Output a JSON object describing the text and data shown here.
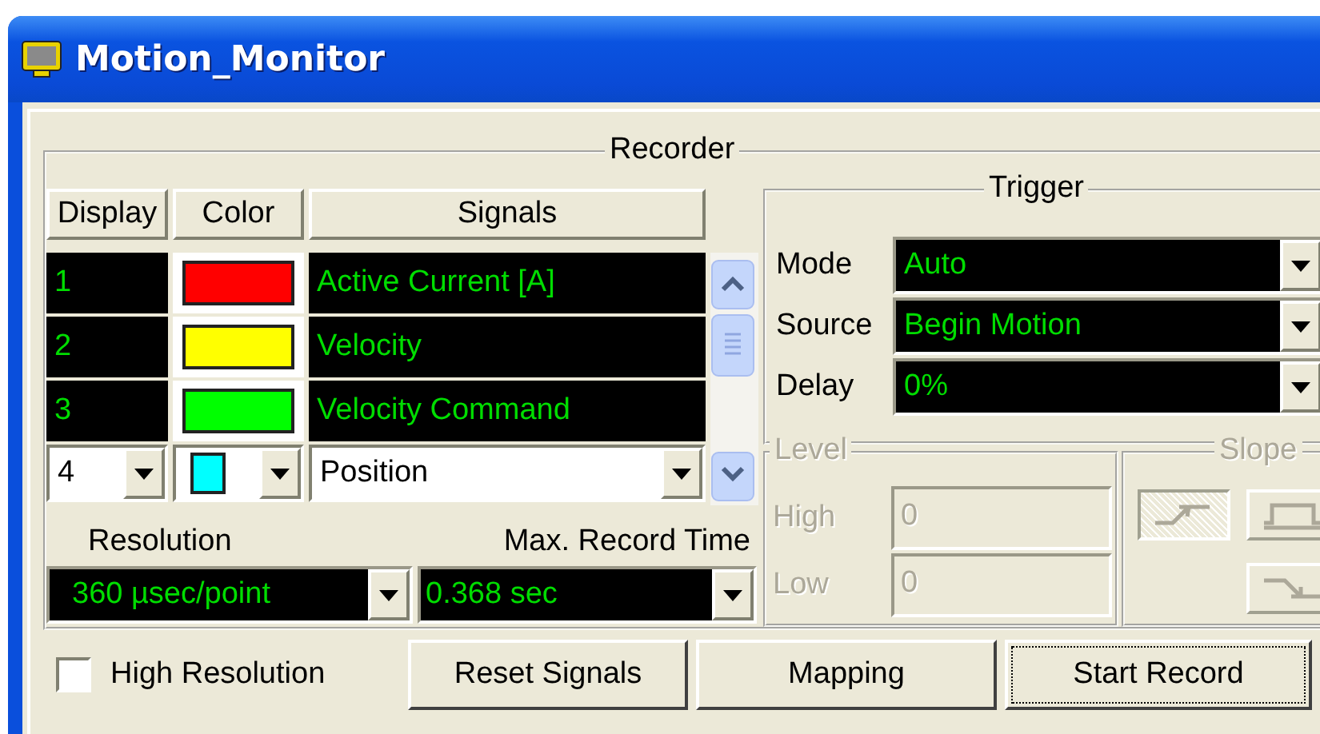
{
  "window": {
    "title": "Motion_Monitor"
  },
  "recorder": {
    "title": "Recorder",
    "columns": [
      "Display",
      "Color",
      "Signals"
    ],
    "rows": [
      {
        "display": "1",
        "color": "#ff0000",
        "signal": "Active Current [A]"
      },
      {
        "display": "2",
        "color": "#ffff00",
        "signal": "Velocity"
      },
      {
        "display": "3",
        "color": "#00ff00",
        "signal": "Velocity Command"
      }
    ],
    "edit_row": {
      "display": "4",
      "color": "#00ffff",
      "signal": "Position"
    },
    "resolution": {
      "label": "Resolution",
      "value": "360 µsec/point"
    },
    "max_record_time": {
      "label": "Max. Record Time",
      "value": "0.368 sec"
    }
  },
  "trigger": {
    "title": "Trigger",
    "fields": [
      {
        "label": "Mode",
        "value": "Auto"
      },
      {
        "label": "Source",
        "value": "Begin Motion"
      },
      {
        "label": "Delay",
        "value": "0%"
      }
    ],
    "level": {
      "title": "Level",
      "disabled": true,
      "fields": [
        {
          "label": "High",
          "value": "0"
        },
        {
          "label": "Low",
          "value": "0"
        }
      ]
    },
    "slope": {
      "title": "Slope",
      "disabled": true,
      "buttons": [
        {
          "kind": "rising",
          "selected": true
        },
        {
          "kind": "both",
          "selected": false
        },
        {
          "kind": "falling",
          "selected": false
        }
      ]
    }
  },
  "high_resolution": {
    "label": "High Resolution",
    "checked": false
  },
  "buttons": [
    {
      "label": "Reset Signals",
      "focused": false
    },
    {
      "label": "Mapping",
      "focused": false
    },
    {
      "label": "Start Record",
      "focused": true
    }
  ]
}
